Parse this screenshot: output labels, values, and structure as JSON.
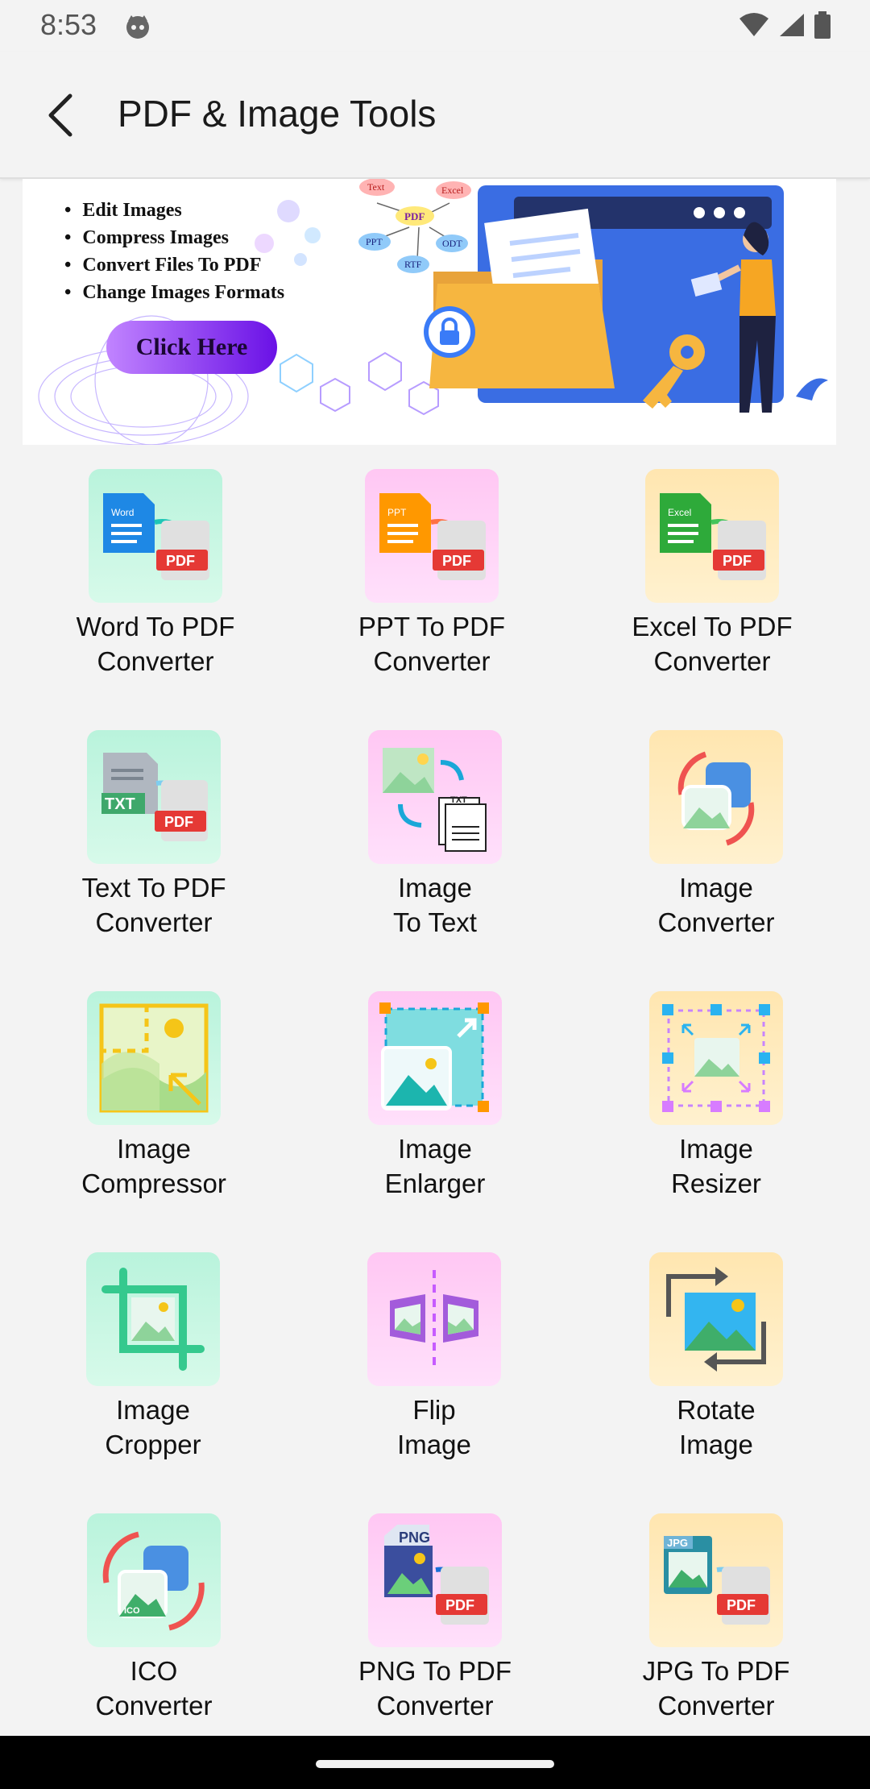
{
  "status_bar": {
    "time": "8:53"
  },
  "app_bar": {
    "title": "PDF & Image Tools"
  },
  "banner": {
    "bullets": [
      "Edit Images",
      "Compress Images",
      "Convert Files To PDF",
      "Change Images Formats"
    ],
    "button_label": "Click Here",
    "diagram_labels": {
      "text": "Text",
      "excel": "Excel",
      "pdf": "PDF",
      "ppt": "PPT",
      "odt": "ODT",
      "rtf": "RTF"
    }
  },
  "tools": [
    {
      "label": "Word To PDF\nConverter",
      "badge": "PDF",
      "doc_tag": "Word"
    },
    {
      "label": "PPT To PDF\nConverter",
      "badge": "PDF",
      "doc_tag": "PPT"
    },
    {
      "label": "Excel To PDF\nConverter",
      "badge": "PDF",
      "doc_tag": "Excel"
    },
    {
      "label": "Text To PDF\nConverter",
      "badge": "PDF",
      "doc_tag": "TXT"
    },
    {
      "label": "Image\nTo Text",
      "doc_tag": "TXT"
    },
    {
      "label": "Image\nConverter"
    },
    {
      "label": "Image\nCompressor"
    },
    {
      "label": "Image\nEnlarger"
    },
    {
      "label": "Image\nResizer"
    },
    {
      "label": "Image\nCropper"
    },
    {
      "label": "Flip\nImage"
    },
    {
      "label": "Rotate\nImage"
    },
    {
      "label": "ICO\nConverter",
      "doc_tag": "ICO"
    },
    {
      "label": "PNG To PDF\nConverter",
      "badge": "PDF",
      "doc_tag": "PNG"
    },
    {
      "label": "JPG To PDF\nConverter",
      "badge": "PDF",
      "doc_tag": "JPG"
    }
  ],
  "colors": {
    "background": "#f3f3f3",
    "pdf_red": "#e53935",
    "banner_button": "#7a1cf0"
  }
}
